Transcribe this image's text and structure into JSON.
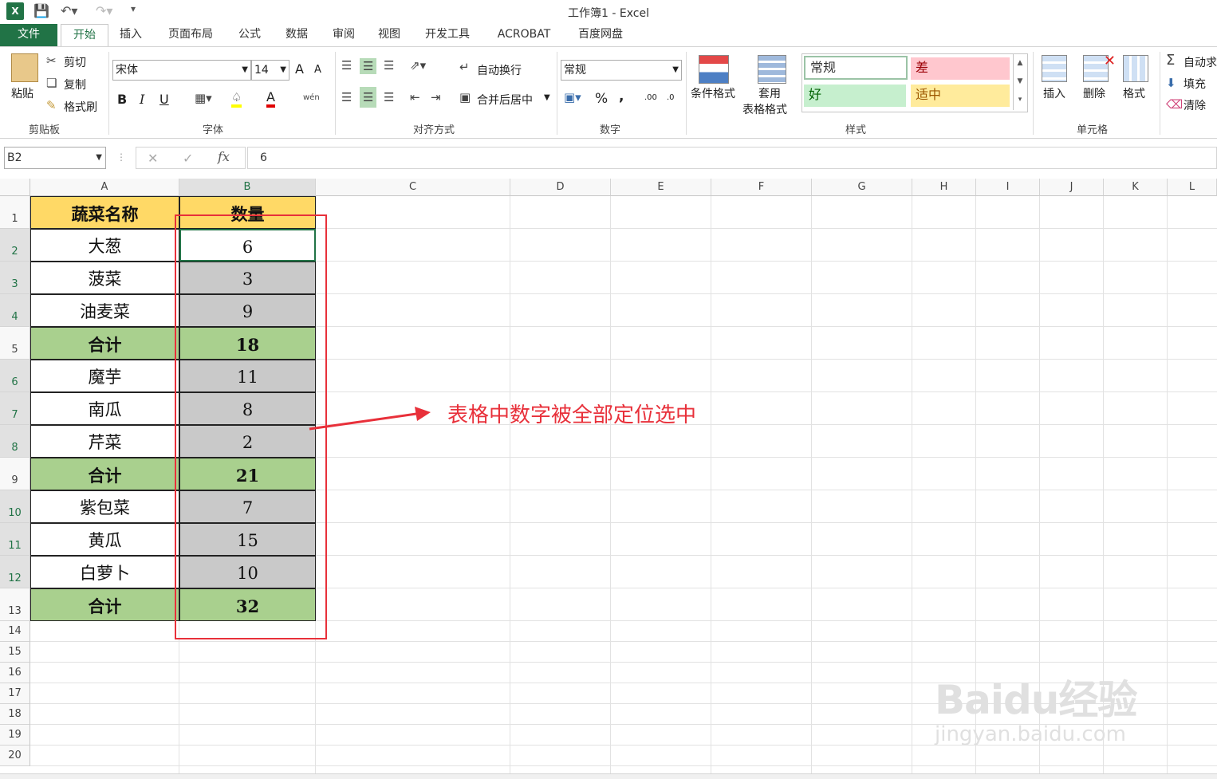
{
  "titlebar": {
    "title": "工作簿1 - Excel",
    "excel_icon": "excel-icon",
    "save_icon": "save-icon",
    "undo_icon": "undo-icon",
    "redo_icon": "redo-icon"
  },
  "tabs": [
    "文件",
    "开始",
    "插入",
    "页面布局",
    "公式",
    "数据",
    "审阅",
    "视图",
    "开发工具",
    "ACROBAT",
    "百度网盘"
  ],
  "active_tab": "开始",
  "ribbon": {
    "clipboard": {
      "paste": "粘贴",
      "cut": "剪切",
      "copy": "复制",
      "format_painter": "格式刷",
      "label": "剪贴板"
    },
    "font": {
      "name": "宋体",
      "size": "14",
      "grow": "A",
      "shrink": "A",
      "bold": "B",
      "italic": "I",
      "underline": "U",
      "font_color": "A",
      "phonetic": "wén",
      "label": "字体"
    },
    "alignment": {
      "wrap": "自动换行",
      "merge": "合并后居中",
      "label": "对齐方式"
    },
    "number": {
      "format": "常规",
      "percent": "%",
      "comma": ",",
      "inc_decimal": ".00",
      "dec_decimal": ".0",
      "label": "数字"
    },
    "styles": {
      "cond_format": "条件格式",
      "table_format_1": "套用",
      "table_format_2": "表格格式",
      "normal": "常规",
      "bad": "差",
      "good": "好",
      "neutral": "适中",
      "label": "样式"
    },
    "cells": {
      "insert": "插入",
      "delete": "删除",
      "format": "格式",
      "label": "单元格"
    },
    "editing": {
      "autosum": "自动求",
      "fill": "填充",
      "clear": "清除"
    }
  },
  "formula_bar": {
    "name_box": "B2",
    "fx": "fx",
    "value": "6"
  },
  "columns": [
    "A",
    "B",
    "C",
    "D",
    "E",
    "F",
    "G",
    "H",
    "I",
    "J",
    "K",
    "L"
  ],
  "rows": [
    "1",
    "2",
    "3",
    "4",
    "5",
    "6",
    "7",
    "8",
    "9",
    "10",
    "11",
    "12",
    "13",
    "14",
    "15",
    "16",
    "17",
    "18",
    "19",
    "20"
  ],
  "table": {
    "header": {
      "name": "蔬菜名称",
      "qty": "数量"
    },
    "rows": [
      {
        "name": "大葱",
        "qty": "6",
        "type": "item"
      },
      {
        "name": "菠菜",
        "qty": "3",
        "type": "item"
      },
      {
        "name": "油麦菜",
        "qty": "9",
        "type": "item"
      },
      {
        "name": "合计",
        "qty": "18",
        "type": "total"
      },
      {
        "name": "魔芋",
        "qty": "11",
        "type": "item"
      },
      {
        "name": "南瓜",
        "qty": "8",
        "type": "item"
      },
      {
        "name": "芹菜",
        "qty": "2",
        "type": "item"
      },
      {
        "name": "合计",
        "qty": "21",
        "type": "total"
      },
      {
        "name": "紫包菜",
        "qty": "7",
        "type": "item"
      },
      {
        "name": "黄瓜",
        "qty": "15",
        "type": "item"
      },
      {
        "name": "白萝卜",
        "qty": "10",
        "type": "item"
      },
      {
        "name": "合计",
        "qty": "32",
        "type": "total"
      }
    ]
  },
  "annotation": {
    "text": "表格中数字被全部定位选中"
  },
  "watermark": {
    "logo": "Baidu经验",
    "url": "jingyan.baidu.com"
  },
  "colors": {
    "excel_green": "#217346",
    "header_yellow": "#ffd966",
    "total_green": "#a9d08e",
    "selected_gray": "#c9c9c9",
    "annotation_red": "#e8303a"
  }
}
